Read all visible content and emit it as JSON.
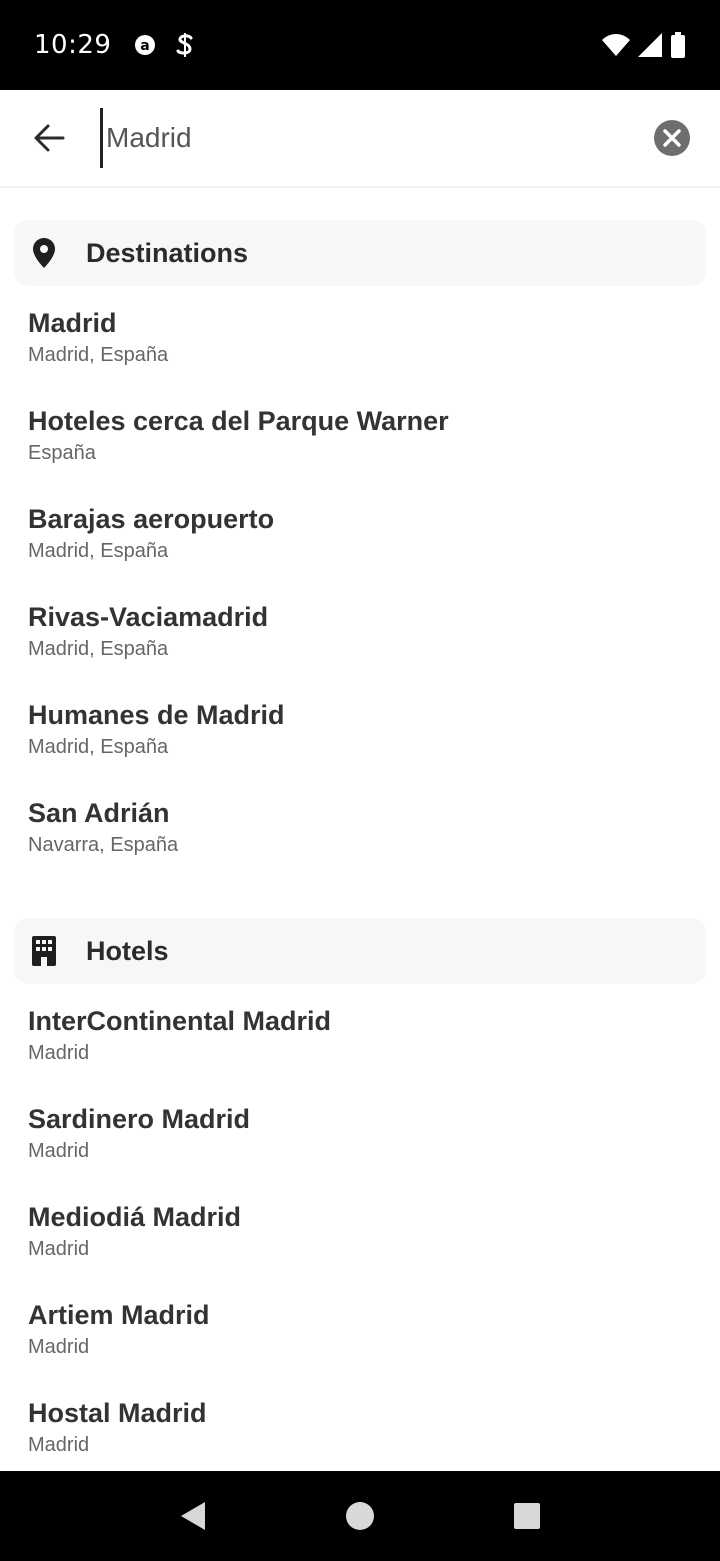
{
  "status_bar": {
    "time": "10:29"
  },
  "search": {
    "value": "Madrid",
    "placeholder": ""
  },
  "sections": {
    "destinations": {
      "title": "Destinations",
      "icon": "location-pin-icon",
      "items": [
        {
          "title": "Madrid",
          "subtitle": "Madrid, España"
        },
        {
          "title": "Hoteles cerca del Parque Warner",
          "subtitle": "España"
        },
        {
          "title": "Barajas aeropuerto",
          "subtitle": "Madrid, España"
        },
        {
          "title": "Rivas-Vaciamadrid",
          "subtitle": "Madrid, España"
        },
        {
          "title": "Humanes de Madrid",
          "subtitle": "Madrid, España"
        },
        {
          "title": "San Adrián",
          "subtitle": "Navarra, España"
        }
      ]
    },
    "hotels": {
      "title": "Hotels",
      "icon": "hotel-building-icon",
      "items": [
        {
          "title": "InterContinental Madrid",
          "subtitle": "Madrid"
        },
        {
          "title": "Sardinero Madrid",
          "subtitle": "Madrid"
        },
        {
          "title": "Mediodiá Madrid",
          "subtitle": "Madrid"
        },
        {
          "title": "Artiem Madrid",
          "subtitle": "Madrid"
        },
        {
          "title": "Hostal Madrid",
          "subtitle": "Madrid"
        }
      ]
    }
  }
}
